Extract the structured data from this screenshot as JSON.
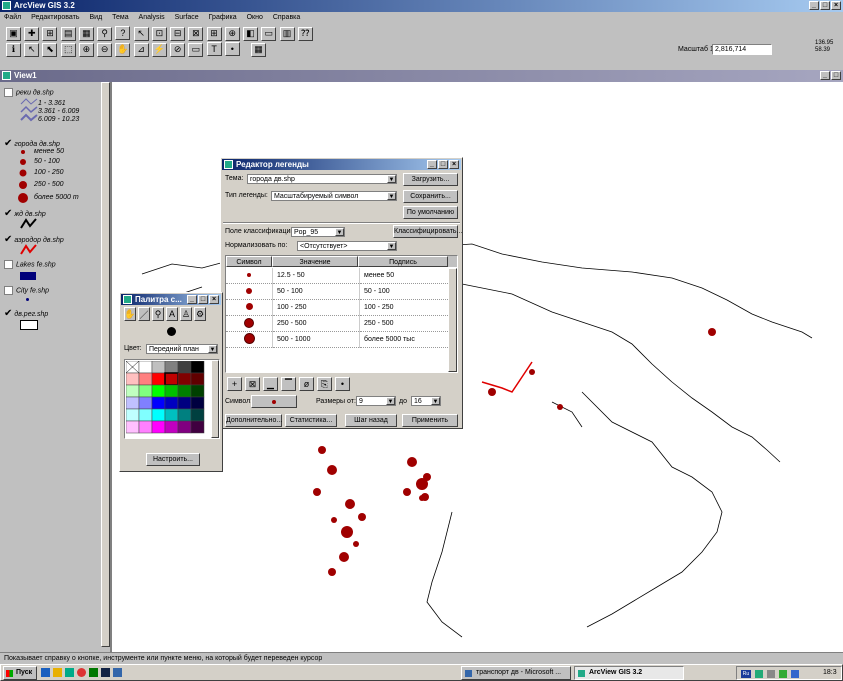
{
  "app": {
    "title": "ArcView GIS 3.2"
  },
  "menu": [
    "Файл",
    "Редактировать",
    "Вид",
    "Тема",
    "Analysis",
    "Surface",
    "Графика",
    "Окно",
    "Справка"
  ],
  "scale": {
    "label": "Масштаб 1:",
    "value": "2,816,714",
    "coords": [
      "136.95",
      "58.39"
    ]
  },
  "view": {
    "title": "View1"
  },
  "toc": {
    "rivers": {
      "name": "реки дв.shp",
      "classes": [
        "1 - 3.361",
        "3.361 - 6.009",
        "6.009 - 10.23"
      ]
    },
    "cities": {
      "name": "города дв.shp",
      "classes": [
        "менее 50",
        "50 - 100",
        "100 - 250",
        "250 - 500",
        "более 5000 т"
      ]
    },
    "rail": {
      "name": "жд дв.shp"
    },
    "airports": {
      "name": "аэродор дв.shp"
    },
    "lakes": {
      "name": "Lakes fe.shp"
    },
    "city_fe": {
      "name": "City fe.shp"
    },
    "regions": {
      "name": "дв.рег.shp"
    }
  },
  "legend_editor": {
    "title": "Редактор легенды",
    "theme_label": "Тема:",
    "theme_value": "города дв.shp",
    "type_label": "Тип легенды:",
    "type_value": "Масштабируемый символ",
    "load": "Загрузить...",
    "save": "Сохранить...",
    "default": "По умолчанию",
    "field_label": "Поле классификации:",
    "field_value": "Pop_95",
    "classify": "Классифицировать...",
    "normalize_label": "Нормализовать по:",
    "normalize_value": "<Отсутствует>",
    "headers": [
      "Символ",
      "Значение",
      "Подпись"
    ],
    "rows": [
      {
        "value": "12.5 - 50",
        "label": "менее 50"
      },
      {
        "value": "50 - 100",
        "label": "50 - 100"
      },
      {
        "value": "100 - 250",
        "label": "100 - 250"
      },
      {
        "value": "250 - 500",
        "label": "250 - 500"
      },
      {
        "value": "500 - 1000",
        "label": "более 5000 тыс"
      }
    ],
    "symbol_label": "Символ:",
    "sizes_label": "Размеры от:",
    "size_from": "9",
    "to_label": "до",
    "size_to": "16",
    "advanced": "Дополнительно...",
    "statistics": "Статистика...",
    "undo": "Шаг назад",
    "apply": "Применить"
  },
  "palette": {
    "title": "Палитра с...",
    "color_label": "Цвет:",
    "color_value": "Передний план",
    "customize": "Настроить..."
  },
  "status": {
    "text": "Показывает справку о кнопке, инструменте или пункте меню, на который будет переведен курсор"
  },
  "taskbar": {
    "start": "Пуск",
    "tasks": [
      "транспорт дв - Microsoft ...",
      "ArcView GIS 3.2"
    ],
    "clock": "18:3"
  },
  "colors": {
    "title_active": "#0a246a",
    "city_red": "#a00000",
    "river": "#6a6ab0",
    "lake": "#00007a"
  }
}
